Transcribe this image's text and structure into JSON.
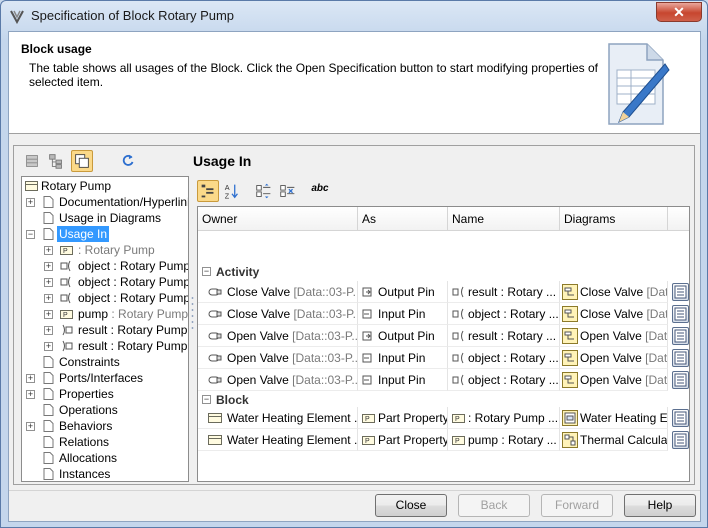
{
  "window": {
    "title": "Specification of Block Rotary Pump",
    "close_label": "✕"
  },
  "header": {
    "title": "Block usage",
    "description": "The table shows all usages of the Block. Click the Open Specification button to start modifying properties of selected item."
  },
  "tree": {
    "root": "Rotary Pump",
    "items": [
      {
        "label": "Documentation/Hyperlinks"
      },
      {
        "label": "Usage in Diagrams"
      },
      {
        "label": "Usage In"
      },
      {
        "label": " : Rotary Pump"
      },
      {
        "label": "object : Rotary Pump"
      },
      {
        "label": "object : Rotary Pump"
      },
      {
        "label": "object : Rotary Pump"
      },
      {
        "name": "pump",
        "label": " : Rotary Pump"
      },
      {
        "label": "result : Rotary Pump"
      },
      {
        "label": "result : Rotary Pump"
      },
      {
        "label": "Constraints"
      },
      {
        "label": "Ports/Interfaces"
      },
      {
        "label": "Properties"
      },
      {
        "label": "Operations"
      },
      {
        "label": "Behaviors"
      },
      {
        "label": "Relations"
      },
      {
        "label": "Allocations"
      },
      {
        "label": "Instances"
      }
    ]
  },
  "panel": {
    "title": "Usage In"
  },
  "toolbar": {
    "abc_label": "abc"
  },
  "table": {
    "columns": [
      "Owner",
      "As",
      "Name",
      "Diagrams"
    ],
    "groups": [
      {
        "label": "Activity"
      },
      {
        "label": "Block"
      }
    ],
    "rows": [
      {
        "owner": "Close Valve",
        "owner_suffix": " [Data::03-P...",
        "as": "Output Pin",
        "name": "result : Rotary ...",
        "diagram": "Close Valve",
        "diagram_suffix": " [Data:"
      },
      {
        "owner": "Close Valve",
        "owner_suffix": " [Data::03-P...",
        "as": "Input Pin",
        "name": "object : Rotary ...",
        "diagram": "Close Valve",
        "diagram_suffix": " [Data:"
      },
      {
        "owner": "Open Valve",
        "owner_suffix": " [Data::03-P...",
        "as": "Output Pin",
        "name": "result : Rotary ...",
        "diagram": "Open Valve",
        "diagram_suffix": " [Data:"
      },
      {
        "owner": "Open Valve",
        "owner_suffix": " [Data::03-P...",
        "as": "Input Pin",
        "name": "object : Rotary ...",
        "diagram": "Open Valve",
        "diagram_suffix": " [Data:"
      },
      {
        "owner": "Open Valve",
        "owner_suffix": " [Data::03-P...",
        "as": "Input Pin",
        "name": "object : Rotary ...",
        "diagram": "Open Valve",
        "diagram_suffix": " [Data:"
      },
      {
        "owner": "Water Heating Element ...",
        "owner_suffix": "",
        "as": "Part Property",
        "name": " : Rotary Pump ...",
        "diagram": "Water Heating Ele",
        "diagram_suffix": ""
      },
      {
        "owner": "Water Heating Element ...",
        "owner_suffix": "",
        "as": "Part Property",
        "name": "pump : Rotary ...",
        "diagram": "Thermal Calculatio",
        "diagram_suffix": ""
      }
    ]
  },
  "buttons": {
    "close": "Close",
    "back": "Back",
    "forward": "Forward",
    "help": "Help"
  }
}
